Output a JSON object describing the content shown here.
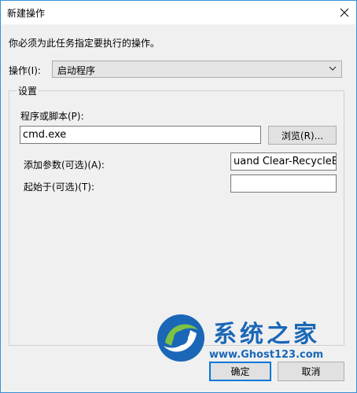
{
  "window": {
    "title": "新建操作",
    "instruction": "你必须为此任务指定要执行的操作。"
  },
  "action": {
    "label": "操作(I):",
    "value": "启动程序"
  },
  "settings": {
    "legend": "设置",
    "program_label": "程序或脚本(P):",
    "program_value": "cmd.exe",
    "browse_label": "浏览(R)...",
    "args_label": "添加参数(可选)(A):",
    "args_value": "uand Clear-RecycleBin\"",
    "start_in_label": "起始于(可选)(T):",
    "start_in_value": ""
  },
  "buttons": {
    "ok": "确定",
    "cancel": "取消"
  },
  "watermark": {
    "name": "系统之家",
    "url": "www.Ghost123.com"
  },
  "colors": {
    "accent": "#0078d7",
    "watermark": "#1a67b7"
  }
}
